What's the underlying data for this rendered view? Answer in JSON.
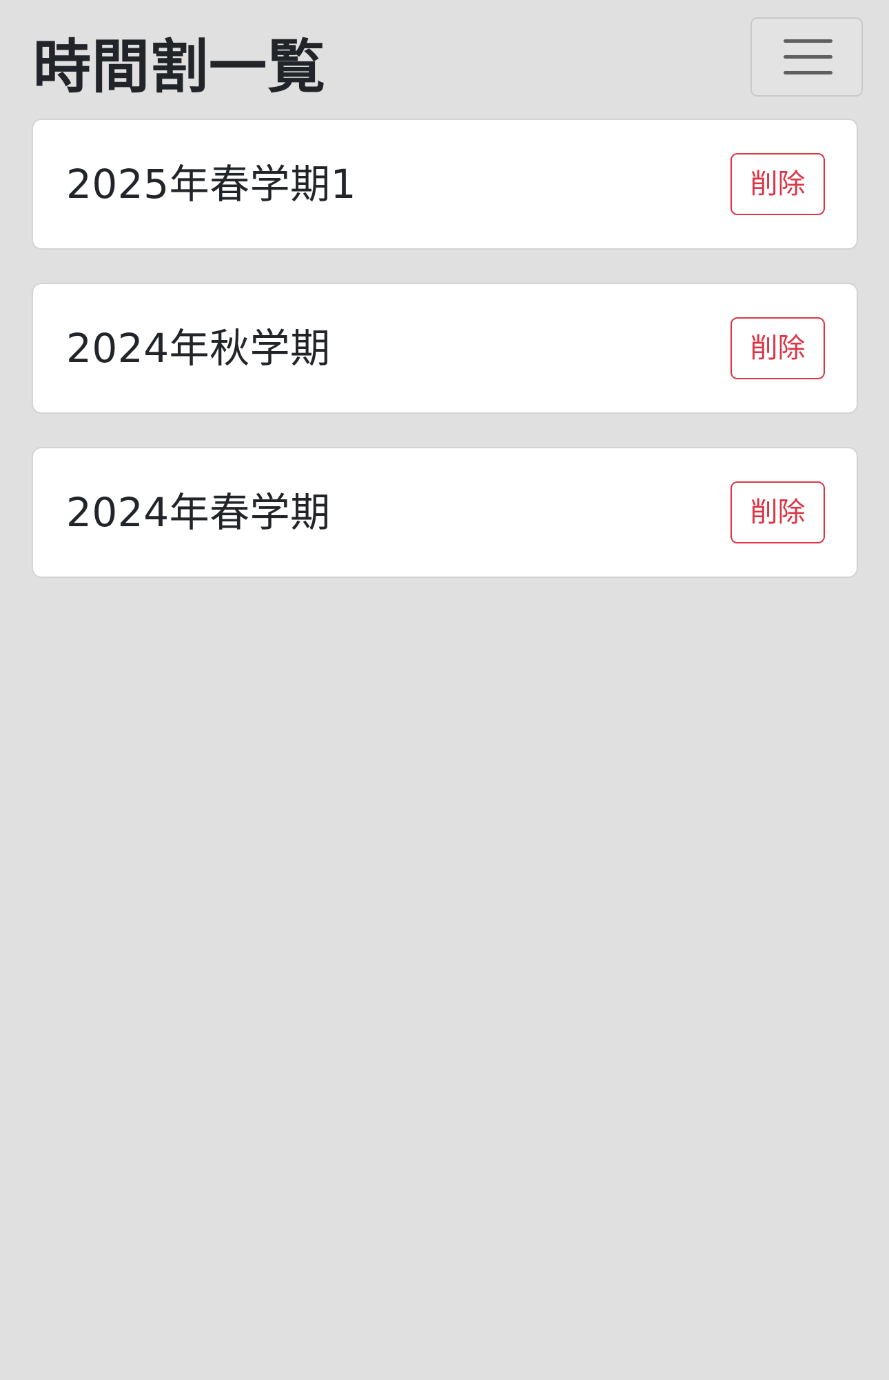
{
  "header": {
    "title": "時間割一覧",
    "menu_icon": "hamburger-menu-icon"
  },
  "timetables": [
    {
      "name": "2025年春学期1",
      "delete_label": "削除"
    },
    {
      "name": "2024年秋学期",
      "delete_label": "削除"
    },
    {
      "name": "2024年春学期",
      "delete_label": "削除"
    }
  ],
  "colors": {
    "background": "#e0e0e0",
    "card": "#ffffff",
    "danger": "#dc3545",
    "text": "#212529"
  }
}
